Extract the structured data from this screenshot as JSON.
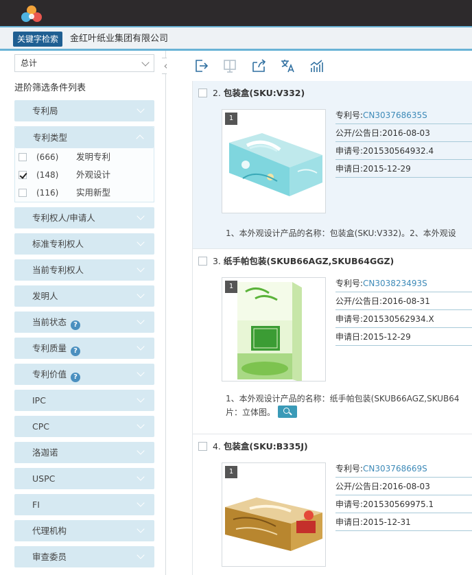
{
  "search": {
    "label": "关键字检索",
    "value": "金红叶纸业集团有限公司"
  },
  "sidebar": {
    "select_value": "总计",
    "title": "进阶筛选条件列表",
    "filters": [
      {
        "label": "专利局"
      },
      {
        "label": "专利类型",
        "open": true,
        "options": [
          {
            "count": "(666)",
            "name": "发明专利",
            "checked": false
          },
          {
            "count": "(148)",
            "name": "外观设计",
            "checked": true
          },
          {
            "count": "(116)",
            "name": "实用新型",
            "checked": false
          }
        ]
      },
      {
        "label": "专利权人/申请人"
      },
      {
        "label": "标准专利权人"
      },
      {
        "label": "当前专利权人"
      },
      {
        "label": "发明人"
      },
      {
        "label": "当前状态",
        "help": "?"
      },
      {
        "label": "专利质量",
        "help": "?"
      },
      {
        "label": "专利价值",
        "help": "?"
      },
      {
        "label": "IPC"
      },
      {
        "label": "CPC"
      },
      {
        "label": "洛迦诺"
      },
      {
        "label": "USPC"
      },
      {
        "label": "FI"
      },
      {
        "label": "代理机构"
      },
      {
        "label": "审查委员"
      }
    ]
  },
  "toolbar": {
    "icons": [
      "export-icon",
      "compare-icon",
      "share-icon",
      "translate-icon",
      "analysis-icon"
    ]
  },
  "results": [
    {
      "index": "2.",
      "title": "包装盒(SKU:V332)",
      "image_num": "1",
      "patent_no_label": "专利号:",
      "patent_no": "CN303768635S",
      "pub_date": "公开/公告日:2016-08-03",
      "app_no": "申请号:201530564932.4",
      "app_date": "申请日:2015-12-29",
      "abstract": "1、本外观设计产品的名称：包装盒(SKU:V332)。2、本外观设",
      "abstract2": ""
    },
    {
      "index": "3.",
      "title": "纸手帕包装(SKUB66AGZ,SKUB64GGZ)",
      "image_num": "1",
      "patent_no_label": "专利号:",
      "patent_no": "CN303823493S",
      "pub_date": "公开/公告日:2016-08-31",
      "app_no": "申请号:201530562934.X",
      "app_date": "申请日:2015-12-29",
      "abstract": "1、本外观设计产品的名称：纸手帕包装(SKUB66AGZ,SKUB64",
      "abstract2": "片：立体图。"
    },
    {
      "index": "4.",
      "title": "包装盒(SKU:B335J)",
      "image_num": "1",
      "patent_no_label": "专利号:",
      "patent_no": "CN303768669S",
      "pub_date": "公开/公告日:2016-08-03",
      "app_no": "申请号:201530569975.1",
      "app_date": "申请日:2015-12-31",
      "abstract": "",
      "abstract2": ""
    }
  ],
  "colors": {
    "topbar": "#2d2a2c",
    "accent": "#1f5f92",
    "filter_bg": "#d6e9f2",
    "link": "#3d8ab8"
  }
}
